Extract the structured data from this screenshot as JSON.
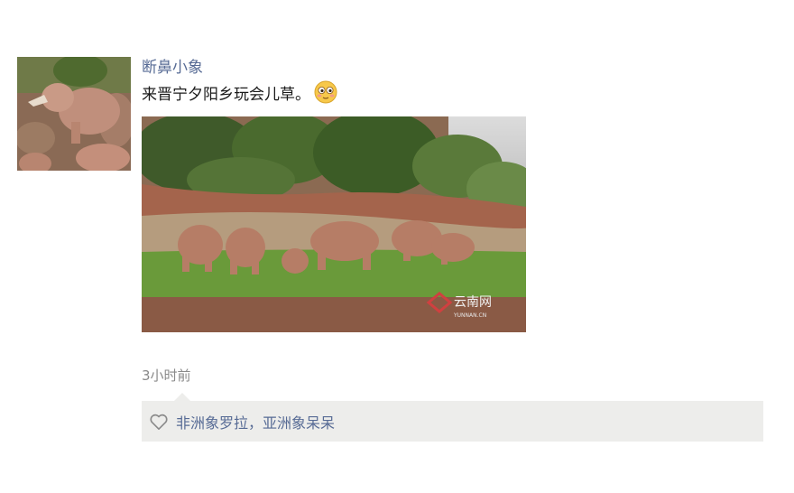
{
  "post": {
    "username": "断鼻小象",
    "text": "来晋宁夕阳乡玩会儿草。",
    "emoji": "shy-smile-emoji",
    "timestamp": "3小时前",
    "image_watermark": "云南网",
    "image_watermark_sub": "YUNNAN.CN"
  },
  "likes": {
    "icon": "heart-outline-icon",
    "names": [
      "非洲象罗拉",
      "亚洲象呆呆"
    ],
    "separator": "，"
  }
}
